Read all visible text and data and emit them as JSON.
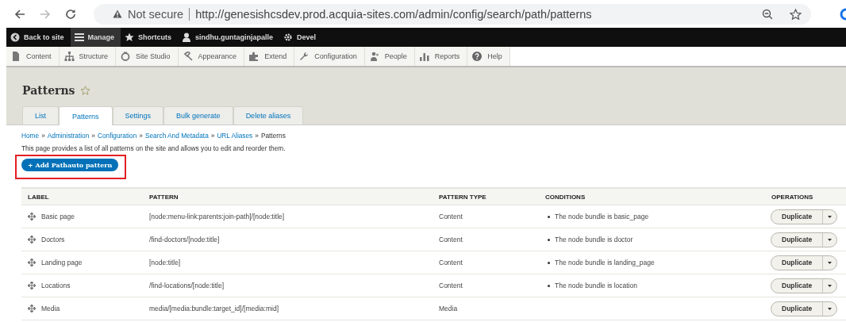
{
  "browser": {
    "security": "Not secure",
    "url": "http://genesishcsdev.prod.acquia-sites.com/admin/config/search/path/patterns",
    "forward_disabled": true
  },
  "toolbar": [
    {
      "label": "Back to site",
      "selected": false
    },
    {
      "label": "Manage",
      "selected": true
    },
    {
      "label": "Shortcuts",
      "selected": false
    },
    {
      "label": "sindhu.guntaginjapalle",
      "selected": false
    },
    {
      "label": "Devel",
      "selected": false
    }
  ],
  "tray": [
    "Content",
    "Structure",
    "Site Studio",
    "Appearance",
    "Extend",
    "Configuration",
    "People",
    "Reports",
    "Help"
  ],
  "page_title": "Patterns",
  "tabs": [
    {
      "label": "List",
      "selected": false
    },
    {
      "label": "Patterns",
      "selected": true
    },
    {
      "label": "Settings",
      "selected": false
    },
    {
      "label": "Bulk generate",
      "selected": false
    },
    {
      "label": "Delete aliases",
      "selected": false
    }
  ],
  "breadcrumb": [
    {
      "kind": "link",
      "text": "Home"
    },
    {
      "kind": "separator",
      "text": "»"
    },
    {
      "kind": "link",
      "text": "Administration"
    },
    {
      "kind": "separator",
      "text": "»"
    },
    {
      "kind": "link",
      "text": "Configuration"
    },
    {
      "kind": "separator",
      "text": "»"
    },
    {
      "kind": "link",
      "text": "Search And Metadata"
    },
    {
      "kind": "separator",
      "text": "»"
    },
    {
      "kind": "link",
      "text": "URL Aliases"
    },
    {
      "kind": "separator",
      "text": "»"
    },
    {
      "kind": "current",
      "text": "Patterns"
    }
  ],
  "description": "This page provides a list of all patterns on the site and allows you to edit and reorder them.",
  "add_button": {
    "label": "+ Add Pathauto pattern",
    "highlighted": true
  },
  "table": {
    "columns": [
      "LABEL",
      "PATTERN",
      "PATTERN TYPE",
      "CONDITIONS",
      "OPERATIONS"
    ],
    "rows": [
      {
        "label": "Basic page",
        "pattern": "[node:menu-link:parents:join-path]/[node:title]",
        "type": "Content",
        "conditions": [
          "The node bundle is basic_page"
        ],
        "operation": "Duplicate"
      },
      {
        "label": "Doctors",
        "pattern": "/find-doctors/[node:title]",
        "type": "Content",
        "conditions": [
          "The node bundle is doctor"
        ],
        "operation": "Duplicate"
      },
      {
        "label": "Landing page",
        "pattern": "[node:title]",
        "type": "Content",
        "conditions": [
          "The node bundle is landing_page"
        ],
        "operation": "Duplicate"
      },
      {
        "label": "Locations",
        "pattern": "/find-locations/[node:title]",
        "type": "Content",
        "conditions": [
          "The node bundle is location"
        ],
        "operation": "Duplicate"
      },
      {
        "label": "Media",
        "pattern": "media/[media:bundle:target_id]/[media:mid]",
        "type": "Media",
        "conditions": [],
        "operation": "Duplicate"
      }
    ]
  }
}
